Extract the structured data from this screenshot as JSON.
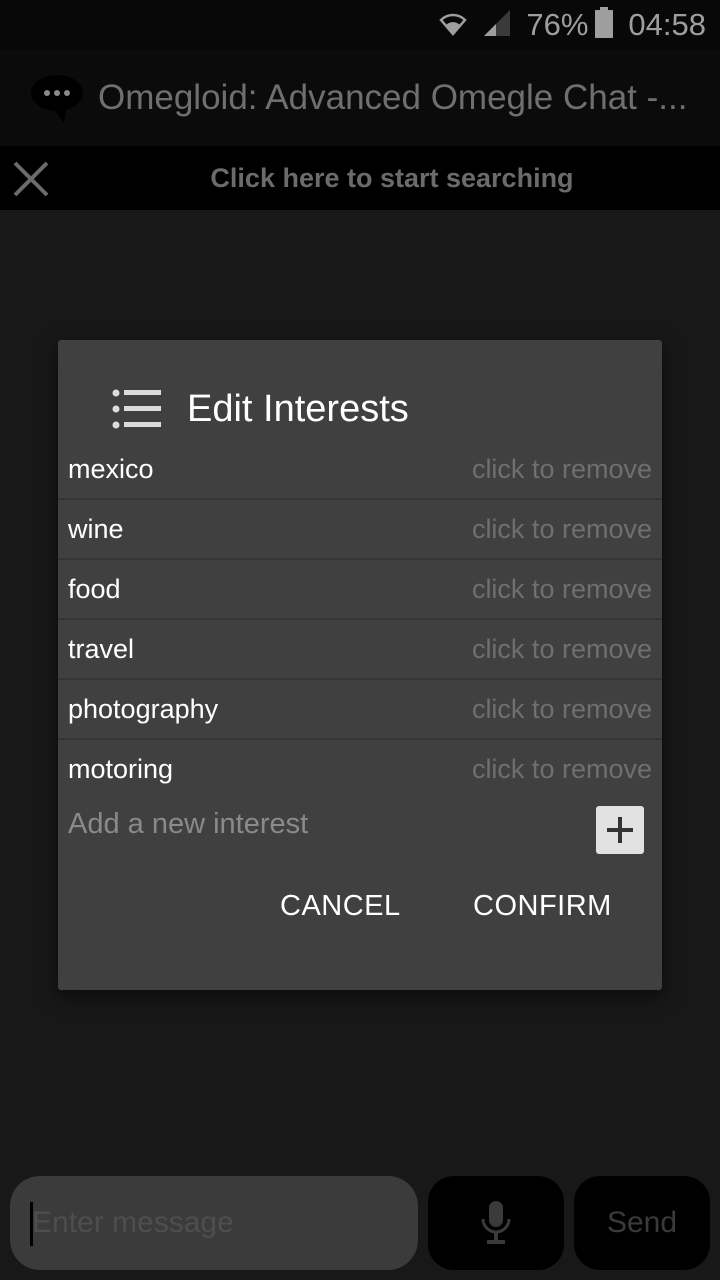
{
  "status_bar": {
    "battery_percent": "76%",
    "time": "04:58",
    "battery_level": 0.76
  },
  "app_bar": {
    "title": "Omegloid: Advanced Omegle Chat -..."
  },
  "search_bar": {
    "label": "Click here to start searching"
  },
  "dialog": {
    "title": "Edit Interests",
    "interests": [
      {
        "name": "mexico",
        "action": "click to remove"
      },
      {
        "name": "wine",
        "action": "click to remove"
      },
      {
        "name": "food",
        "action": "click to remove"
      },
      {
        "name": "travel",
        "action": "click to remove"
      },
      {
        "name": "photography",
        "action": "click to remove"
      },
      {
        "name": "motoring",
        "action": "click to remove"
      }
    ],
    "add_placeholder": "Add a new interest",
    "cancel_label": "CANCEL",
    "confirm_label": "CONFIRM"
  },
  "composer": {
    "placeholder": "Enter message",
    "send_label": "Send"
  },
  "colors": {
    "dialog_bg": "#404040",
    "page_bg": "#181818",
    "muted_text": "#6f6f6f"
  }
}
